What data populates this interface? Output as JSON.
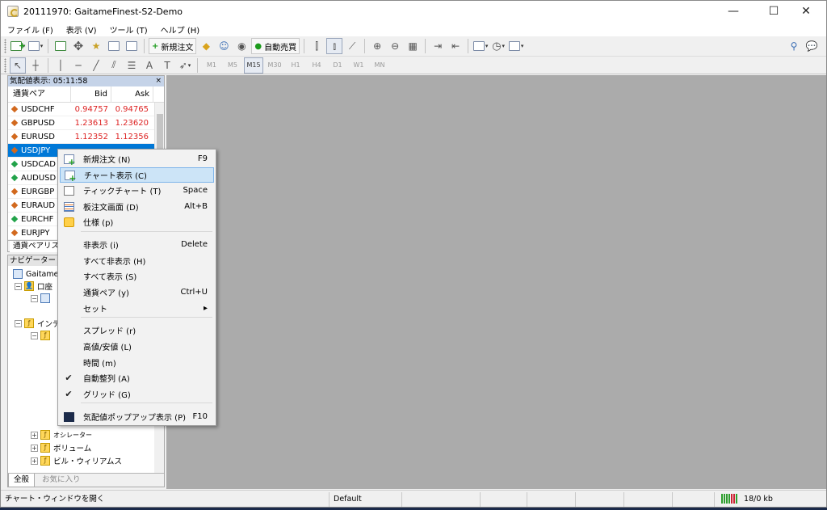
{
  "window": {
    "title": "20111970: GaitameFinest-S2-Demo",
    "controls": {
      "minimize": "—",
      "maximize": "☐",
      "close": "✕"
    }
  },
  "menu": [
    "ファイル (F)",
    "表示 (V)",
    "ツール (T)",
    "ヘルプ (H)"
  ],
  "toolbar": {
    "new_order": "新規注文",
    "auto_trade": "自動売買"
  },
  "timeframes": [
    "M1",
    "M5",
    "M15",
    "M30",
    "H1",
    "H4",
    "D1",
    "W1",
    "MN"
  ],
  "timeframe_selected": "M15",
  "market_watch": {
    "title": "気配値表示: 05:11:58",
    "close": "×",
    "headers": {
      "symbol": "通貨ペア",
      "bid": "Bid",
      "ask": "Ask"
    },
    "rows": [
      {
        "symbol": "USDCHF",
        "bid": "0.94757",
        "ask": "0.94765",
        "dir": "down"
      },
      {
        "symbol": "GBPUSD",
        "bid": "1.23613",
        "ask": "1.23620",
        "dir": "down"
      },
      {
        "symbol": "EURUSD",
        "bid": "1.12352",
        "ask": "1.12356",
        "dir": "down"
      },
      {
        "symbol": "USDJPY",
        "bid": "",
        "ask": "",
        "dir": "down",
        "selected": true
      },
      {
        "symbol": "USDCAD",
        "bid": "",
        "ask": "",
        "dir": "up"
      },
      {
        "symbol": "AUDUSD",
        "bid": "",
        "ask": "",
        "dir": "up"
      },
      {
        "symbol": "EURGBP",
        "bid": "",
        "ask": "",
        "dir": "down"
      },
      {
        "symbol": "EURAUD",
        "bid": "",
        "ask": "",
        "dir": "down"
      },
      {
        "symbol": "EURCHF",
        "bid": "",
        "ask": "",
        "dir": "up"
      },
      {
        "symbol": "EURJPY",
        "bid": "",
        "ask": "",
        "dir": "down"
      }
    ],
    "tab": "通貨ペアリス"
  },
  "navigator": {
    "title": "ナビゲーター",
    "root": "Gaitame",
    "accounts": "口座",
    "indicators": "インデ",
    "oscillators": "オシレーター",
    "volumes": "ボリューム",
    "bill_williams": "ビル・ウィリアムス",
    "tabs": {
      "all": "全般",
      "favorites": "お気に入り"
    }
  },
  "context_menu": {
    "items": [
      {
        "label": "新規注文 (N)",
        "key": "F9",
        "icon": "new-order-icon"
      },
      {
        "label": "チャート表示 (C)",
        "key": "",
        "icon": "chart-window-icon",
        "highlighted": true
      },
      {
        "label": "ティックチャート (T)",
        "key": "Space",
        "icon": "tick-chart-icon"
      },
      {
        "label": "板注文画面 (D)",
        "key": "Alt+B",
        "icon": "depth-of-market-icon"
      },
      {
        "label": "仕様 (p)",
        "key": "",
        "icon": "specification-icon"
      },
      {
        "label": "非表示 (i)",
        "key": "Delete"
      },
      {
        "label": "すべて非表示 (H)",
        "key": ""
      },
      {
        "label": "すべて表示 (S)",
        "key": ""
      },
      {
        "label": "通貨ペア (y)",
        "key": "Ctrl+U"
      },
      {
        "label": "セット",
        "key": "▸"
      },
      {
        "label": "スプレッド (r)",
        "key": ""
      },
      {
        "label": "高値/安値 (L)",
        "key": ""
      },
      {
        "label": "時間 (m)",
        "key": ""
      },
      {
        "label": "自動整列 (A)",
        "key": "",
        "checked": true
      },
      {
        "label": "グリッド (G)",
        "key": "",
        "checked": true
      },
      {
        "label": "気配値ポップアップ表示 (P)",
        "key": "F10",
        "icon": "popup-prices-icon"
      }
    ],
    "check_glyph": "✔"
  },
  "statusbar": {
    "hint": "チャート・ウィンドウを開く",
    "profile": "Default",
    "traffic": "18/0 kb"
  },
  "colors": {
    "selection": "#0078d7",
    "price_down": "#dd2222",
    "client_bg": "#ababab"
  }
}
